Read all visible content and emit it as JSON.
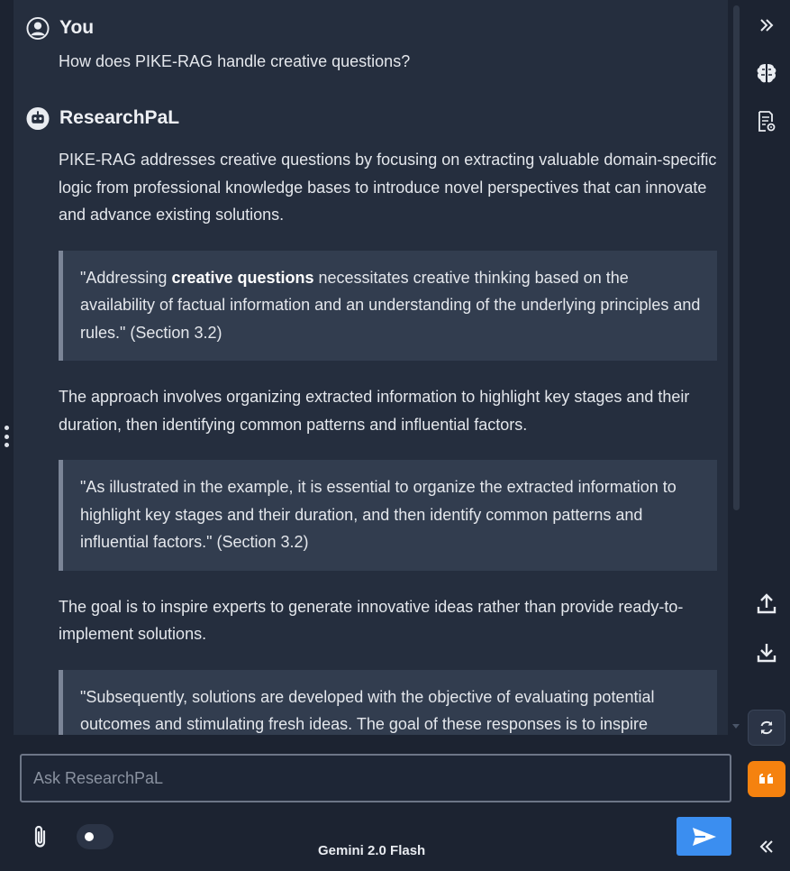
{
  "user_message": {
    "author": "You",
    "text": "How does PIKE-RAG handle creative questions?"
  },
  "assistant_message": {
    "author": "ResearchPaL",
    "blocks": {
      "p1": "PIKE-RAG addresses creative questions by focusing on extracting valuable domain-specific logic from professional knowledge bases to introduce novel perspectives that can innovate and advance existing solutions.",
      "q1_before": "\"Addressing ",
      "q1_bold": "creative questions",
      "q1_after": " necessitates creative thinking based on the availability of factual information and an understanding of the underlying principles and rules.\" (Section 3.2)",
      "p2": "The approach involves organizing extracted information to highlight key stages and their duration, then identifying common patterns and influential factors.",
      "q2": "\"As illustrated in the example, it is essential to organize the extracted information to highlight key stages and their duration, and then identify common patterns and influential factors.\" (Section 3.2)",
      "p3": "The goal is to inspire experts to generate innovative ideas rather than provide ready-to-implement solutions.",
      "q3": "\"Subsequently, solutions are developed with the objective of evaluating potential outcomes and stimulating fresh ideas. The goal of these responses is to inspire experts to generate innovative ideas, rather than to provide ready-to-implement"
    }
  },
  "input": {
    "placeholder": "Ask ResearchPaL",
    "value": ""
  },
  "footer": {
    "model_label": "Gemini 2.0 Flash"
  },
  "rail": {
    "icons": [
      "double-chevron-right-icon",
      "brain-icon",
      "document-settings-icon",
      "upload-icon",
      "download-icon",
      "refresh-icon",
      "quote-icon",
      "double-chevron-left-icon"
    ]
  },
  "colors": {
    "background": "#1c2331",
    "message_bg": "#252e3e",
    "quote_bg": "#323d4f",
    "send_button": "#3b8ef0",
    "quote_button": "#f5820f"
  }
}
